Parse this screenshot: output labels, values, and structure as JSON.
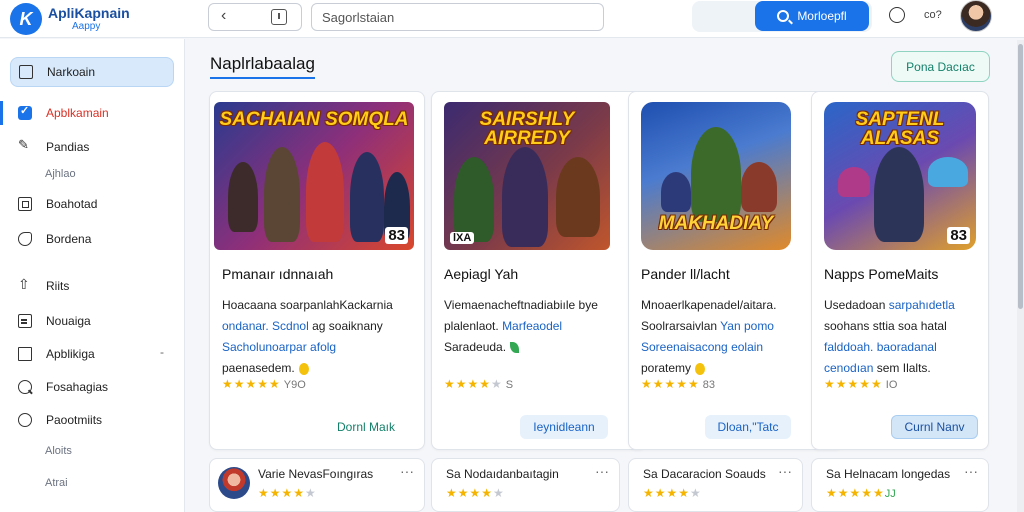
{
  "app": {
    "logo_glyph": "K",
    "brand_name": "ApliKapnain",
    "brand_sub": "Aappy"
  },
  "topbar": {
    "search_value": "Sagorlstaian",
    "search_button_label": "Morloepfl",
    "short_text": "co?"
  },
  "sidebar": {
    "items": [
      {
        "label": "Narkoain",
        "icon": "inbox-icon"
      },
      {
        "label": "Apblkamain",
        "icon": "check-icon"
      },
      {
        "label": "Pandias",
        "icon": "edit-icon"
      },
      {
        "label": "Boahotad",
        "icon": "grid-icon"
      },
      {
        "label": "Bordena",
        "icon": "tag-icon"
      },
      {
        "label": "Riits",
        "icon": "upload-icon"
      },
      {
        "label": "Nouaiga",
        "icon": "document-icon"
      },
      {
        "label": "Apblikiga",
        "icon": "square-icon"
      },
      {
        "label": "Fosahagias",
        "icon": "search-icon"
      },
      {
        "label": "Paootmiits",
        "icon": "circle-icon"
      }
    ],
    "sub_items": [
      "Ajhlao",
      "Aloits",
      "Atrai"
    ],
    "expand_glyph": "-"
  },
  "main": {
    "title": "Naplrlabaalag",
    "top_action_label": "Pona Dacıac"
  },
  "cards": [
    {
      "art_title": "SACHAIAN SOMQLA",
      "badge": "83",
      "title": "Pmanaır ıdnnaıah",
      "desc_plain_1": "Hoacaana soarpanlahKackarnia",
      "desc_hl_1": "ondanar. Scdnol",
      "desc_plain_2": "ag soaiknany",
      "desc_hl_2": "Sacholunoarpar afolg",
      "desc_plain_3": "paenasedem.",
      "stars": "★★★★★",
      "rating_text": "Y9O",
      "button_label": "Dornl Maık",
      "colors": {
        "bg1": "#2a3b8f",
        "bg2": "#d9472b"
      }
    },
    {
      "art_title": "SAIRSHLY AIRREDY",
      "badge": "lXA",
      "title": "Aepiagl Yah",
      "desc_plain_1": "Viemaenacheftnadiabiıle bye",
      "desc_plain_2": "plalenlaot.",
      "desc_hl_1": "Marfeaodel",
      "desc_plain_3": "Saradeuda.",
      "stars": "★★★★",
      "stars_gray": "★",
      "rating_text": "S",
      "button_label": "Ieynidleann",
      "colors": {
        "bg1": "#3b2a70",
        "bg2": "#c0562c"
      }
    },
    {
      "art_title": "MAKHADIAY",
      "badge": "",
      "title": "Pander ll/lacht",
      "desc_plain_1": "Mnoaerlkapenadel/aitara.",
      "desc_plain_2": "Soolrarsaivlan",
      "desc_hl_1": "Yan pomo",
      "desc_hl_2": "Soreenaisacong eolain",
      "desc_plain_3": "poratemy",
      "stars": "★★★★★",
      "rating_text": "83",
      "button_label": "Dloan,\"Tatc",
      "colors": {
        "bg1": "#1f4fb0",
        "bg2": "#e08a2a"
      }
    },
    {
      "art_title": "SAPTENL ALASAS",
      "badge": "83",
      "title": "Napps PomeMaits",
      "desc_plain_1": "Usedadoan",
      "desc_hl_1": "sarpahıdetla",
      "desc_plain_2": "soohans sttia soa hatal",
      "desc_hl_2": "falddoah. baoradanal",
      "desc_hl_3": "cenodıan",
      "desc_plain_3": "sem Ilalts.",
      "stars": "★★★★★",
      "rating_text": "IO",
      "button_label": "Curnl Nanv",
      "colors": {
        "bg1": "#2a66c8",
        "bg2": "#e0a02a"
      }
    }
  ],
  "mini_cards": [
    {
      "title": "Varie NevasFoıngıras",
      "stars": "★★★★",
      "gray": "★",
      "extra": ""
    },
    {
      "title": "Sa Nodaıdanbaıtagin",
      "stars": "★★★★",
      "gray": "★",
      "extra": ""
    },
    {
      "title": "Sa Dacaracion Soauds",
      "stars": "★★★★",
      "gray": "★",
      "extra": ""
    },
    {
      "title": "Sa Helnacam longedas",
      "stars": "★★★★★",
      "gray": "",
      "extra": "JJ"
    }
  ],
  "icons": {
    "back": "chevron-left-icon",
    "history": "history-icon",
    "search": "search-icon",
    "account": "circle-icon",
    "more": "more-horizontal-icon"
  },
  "colors": {
    "accent": "#1a73e8",
    "active_nav": "#d7e9fb",
    "danger": "#d93025",
    "star": "#f5b400",
    "teal": "#14806a"
  }
}
